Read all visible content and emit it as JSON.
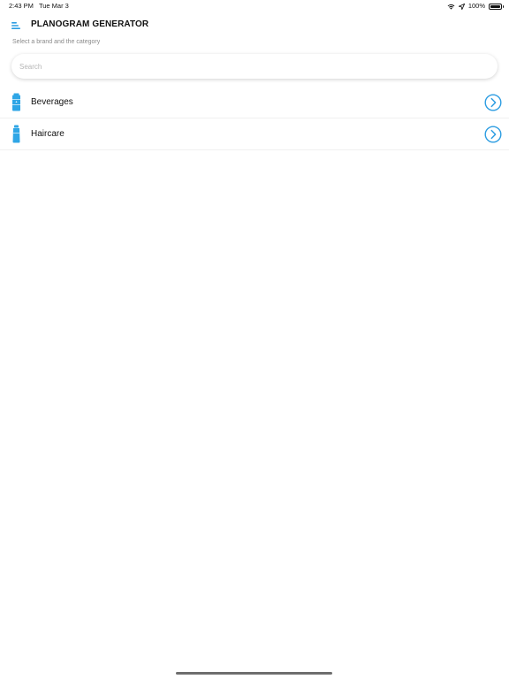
{
  "status_bar": {
    "time": "2:43 PM",
    "date": "Tue Mar 3",
    "battery_text": "100%",
    "battery_level": 1.0,
    "icons": [
      "wifi-icon",
      "location-arrow-icon",
      "battery-icon"
    ]
  },
  "header": {
    "title": "PLANOGRAM GENERATOR",
    "menu_icon": "hamburger-menu-icon",
    "subtitle": "Select a brand and the category"
  },
  "search": {
    "placeholder": "Search",
    "value": ""
  },
  "categories": [
    {
      "label": "Beverages",
      "icon": "beverage-bottle-icon",
      "action_icon": "chevron-right-circle-icon"
    },
    {
      "label": "Haircare",
      "icon": "haircare-bottle-icon",
      "action_icon": "chevron-right-circle-icon"
    }
  ],
  "colors": {
    "accent": "#2d9de2",
    "icon_blue": "#2fa6e6",
    "text": "#111111",
    "subtitle": "#8a8a8a",
    "placeholder": "#b5b5b5",
    "divider": "#f0f0f0",
    "home_indicator": "#6e6e6e"
  }
}
